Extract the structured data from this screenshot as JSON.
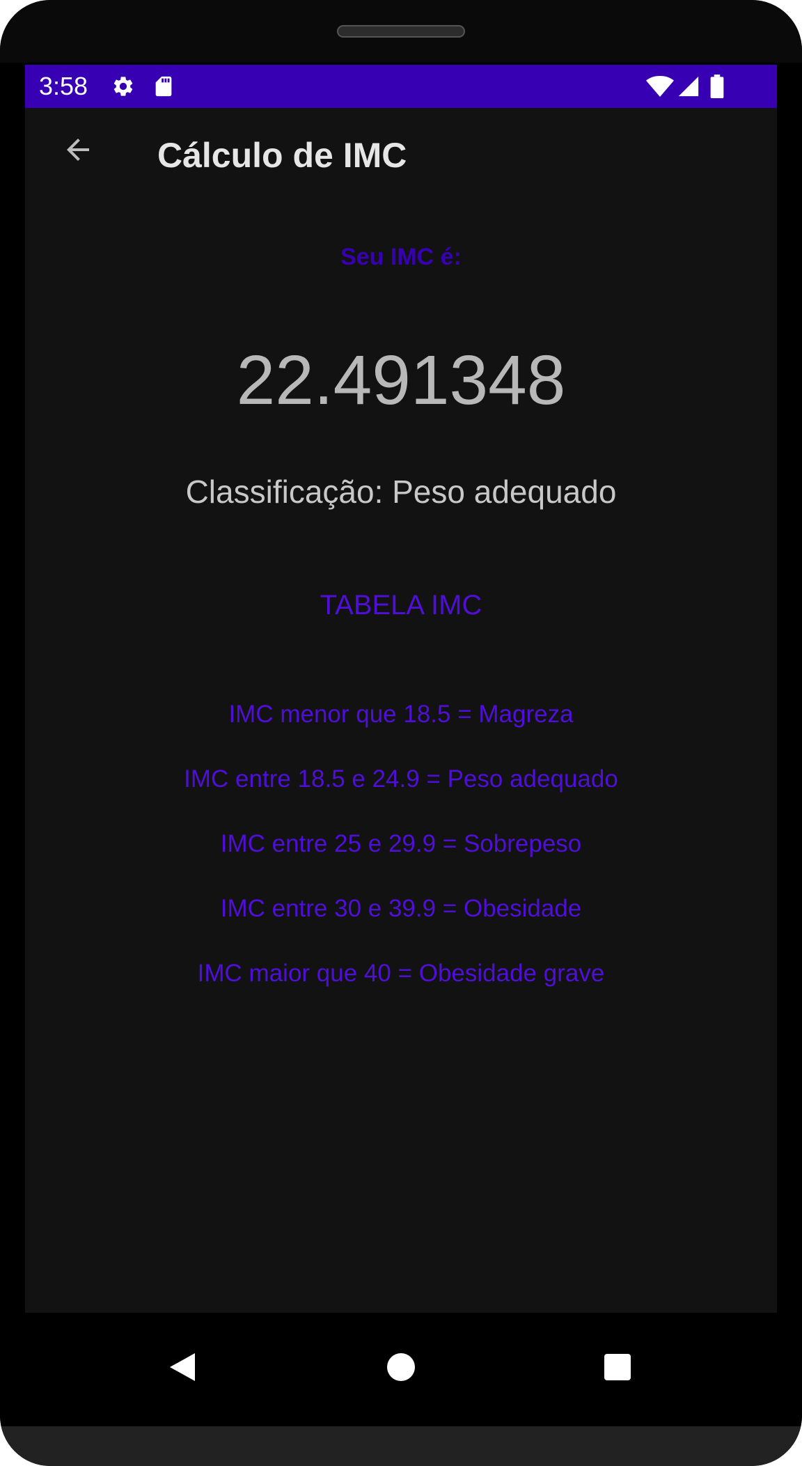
{
  "status_bar": {
    "time": "3:58",
    "left_icons": [
      "gear-icon",
      "sd-card-icon"
    ],
    "right_icons": [
      "wifi-icon",
      "cell-signal-icon",
      "battery-icon"
    ],
    "background_color": "#3700b3"
  },
  "app_bar": {
    "back_icon": "arrow-back-icon",
    "title": "Cálculo de IMC"
  },
  "result": {
    "label": "Seu IMC é:",
    "value": "22.491348",
    "classification": "Classificação: Peso adequado"
  },
  "table": {
    "title": "TABELA IMC",
    "rows": [
      "IMC menor que 18.5 = Magreza",
      "IMC entre 18.5 e 24.9 = Peso adequado",
      "IMC entre 25 e 29.9 = Sobrepeso",
      "IMC entre 30 e 39.9 = Obesidade",
      "IMC maior que 40 = Obesidade grave"
    ]
  },
  "nav_bar": {
    "buttons": [
      "back-triangle-icon",
      "home-circle-icon",
      "recents-square-icon"
    ]
  },
  "colors": {
    "accent": "#3700b3",
    "table_text": "#4f0fd9",
    "background": "#121212"
  }
}
